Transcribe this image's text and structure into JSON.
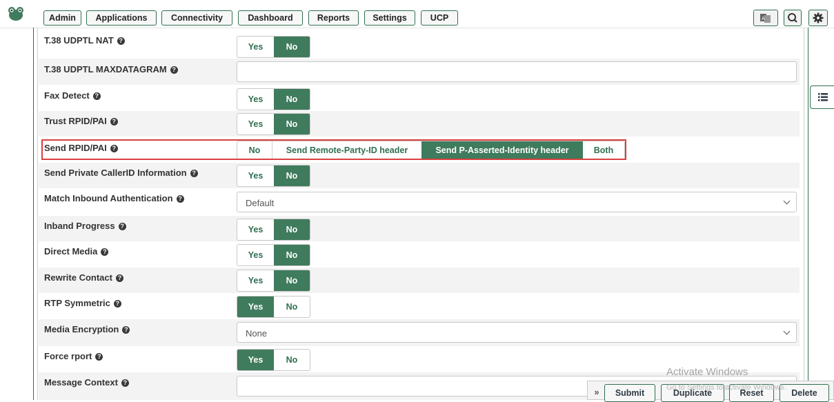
{
  "nav": {
    "items": [
      "Admin",
      "Applications",
      "Connectivity",
      "Dashboard",
      "Reports",
      "Settings",
      "UCP"
    ]
  },
  "rows": [
    {
      "label": "T.38 UDPTL NAT",
      "type": "toggle",
      "options": [
        "Yes",
        "No"
      ],
      "selected": "No"
    },
    {
      "label": "T.38 UDPTL MAXDATAGRAM",
      "type": "text",
      "value": ""
    },
    {
      "label": "Fax Detect",
      "type": "toggle",
      "options": [
        "Yes",
        "No"
      ],
      "selected": "No"
    },
    {
      "label": "Trust RPID/PAI",
      "type": "toggle",
      "options": [
        "Yes",
        "No"
      ],
      "selected": "No"
    },
    {
      "label": "Send RPID/PAI",
      "type": "toggle",
      "options": [
        "No",
        "Send Remote-Party-ID header",
        "Send P-Asserted-Identity header",
        "Both"
      ],
      "selected": "Send P-Asserted-Identity header"
    },
    {
      "label": "Send Private CallerID Information",
      "type": "toggle",
      "options": [
        "Yes",
        "No"
      ],
      "selected": "No"
    },
    {
      "label": "Match Inbound Authentication",
      "type": "select",
      "value": "Default"
    },
    {
      "label": "Inband Progress",
      "type": "toggle",
      "options": [
        "Yes",
        "No"
      ],
      "selected": "No"
    },
    {
      "label": "Direct Media",
      "type": "toggle",
      "options": [
        "Yes",
        "No"
      ],
      "selected": "No"
    },
    {
      "label": "Rewrite Contact",
      "type": "toggle",
      "options": [
        "Yes",
        "No"
      ],
      "selected": "No"
    },
    {
      "label": "RTP Symmetric",
      "type": "toggle",
      "options": [
        "Yes",
        "No"
      ],
      "selected": "Yes"
    },
    {
      "label": "Media Encryption",
      "type": "select",
      "value": "None"
    },
    {
      "label": "Force rport",
      "type": "toggle",
      "options": [
        "Yes",
        "No"
      ],
      "selected": "Yes"
    },
    {
      "label": "Message Context",
      "type": "text",
      "value": ""
    }
  ],
  "actions": {
    "expand": "»",
    "submit": "Submit",
    "duplicate": "Duplicate",
    "reset": "Reset",
    "delete": "Delete"
  },
  "watermark": {
    "line1": "Activate Windows",
    "line2": "Go to Settings to activate Windows."
  },
  "colors": {
    "accent": "#3f7b5d",
    "border": "#2f6f4f",
    "highlight": "#d9403e"
  }
}
